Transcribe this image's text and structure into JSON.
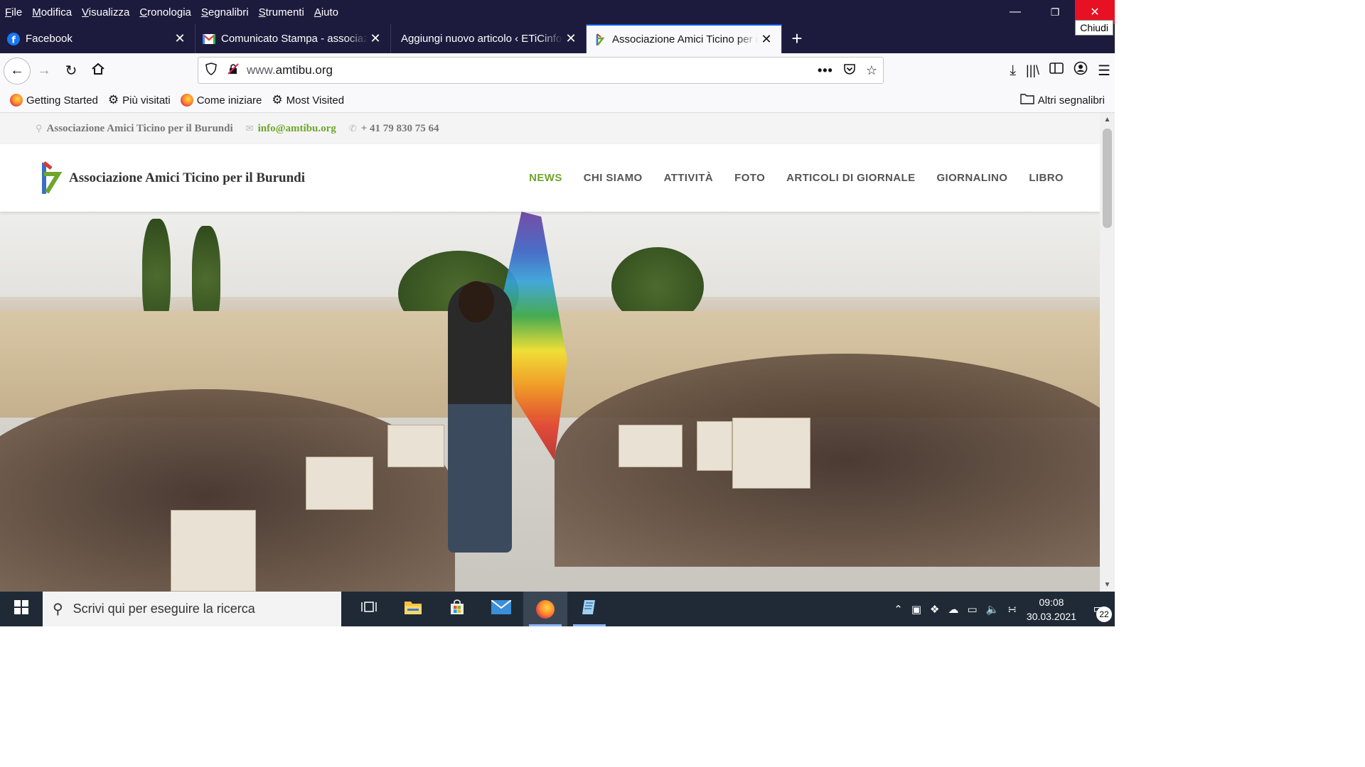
{
  "menubar": {
    "items": [
      "File",
      "Modifica",
      "Visualizza",
      "Cronologia",
      "Segnalibri",
      "Strumenti",
      "Aiuto"
    ],
    "underlined": [
      "F",
      "M",
      "V",
      "C",
      "S",
      "S",
      "A"
    ],
    "close_tooltip": "Chiudi"
  },
  "tabs": [
    {
      "title": "Facebook",
      "icon": "facebook-icon"
    },
    {
      "title": "Comunicato Stampa - associazione",
      "icon": "gmail-icon"
    },
    {
      "title": "Aggiungi nuovo articolo ‹ ETiCinforma",
      "icon": "none"
    },
    {
      "title": "Associazione Amici Ticino per il Burundi",
      "icon": "amtibu-icon",
      "active": true
    }
  ],
  "navbar": {
    "url_dim": "www.",
    "url_main": "amtibu.org"
  },
  "bookmarks": {
    "items": [
      {
        "label": "Getting Started",
        "icon": "firefox-icon"
      },
      {
        "label": "Più visitati",
        "icon": "gear-icon"
      },
      {
        "label": "Come iniziare",
        "icon": "firefox-icon"
      },
      {
        "label": "Most Visited",
        "icon": "gear-icon"
      }
    ],
    "other": "Altri segnalibri"
  },
  "site": {
    "topinfo": {
      "address": "Associazione Amici Ticino per il Burundi",
      "email": "info@amtibu.org",
      "phone": "+ 41 79 830 75 64"
    },
    "name": "Associazione Amici Ticino per il Burundi",
    "nav": [
      "NEWS",
      "CHI SIAMO",
      "ATTIVITÀ",
      "FOTO",
      "ARTICOLI DI GIORNALE",
      "GIORNALINO",
      "LIBRO"
    ],
    "nav_active": "NEWS",
    "accent_color": "#6ea62c"
  },
  "taskbar": {
    "search_placeholder": "Scrivi qui per eseguire la ricerca",
    "time": "09:08",
    "date": "30.03.2021",
    "notifications": "22"
  }
}
